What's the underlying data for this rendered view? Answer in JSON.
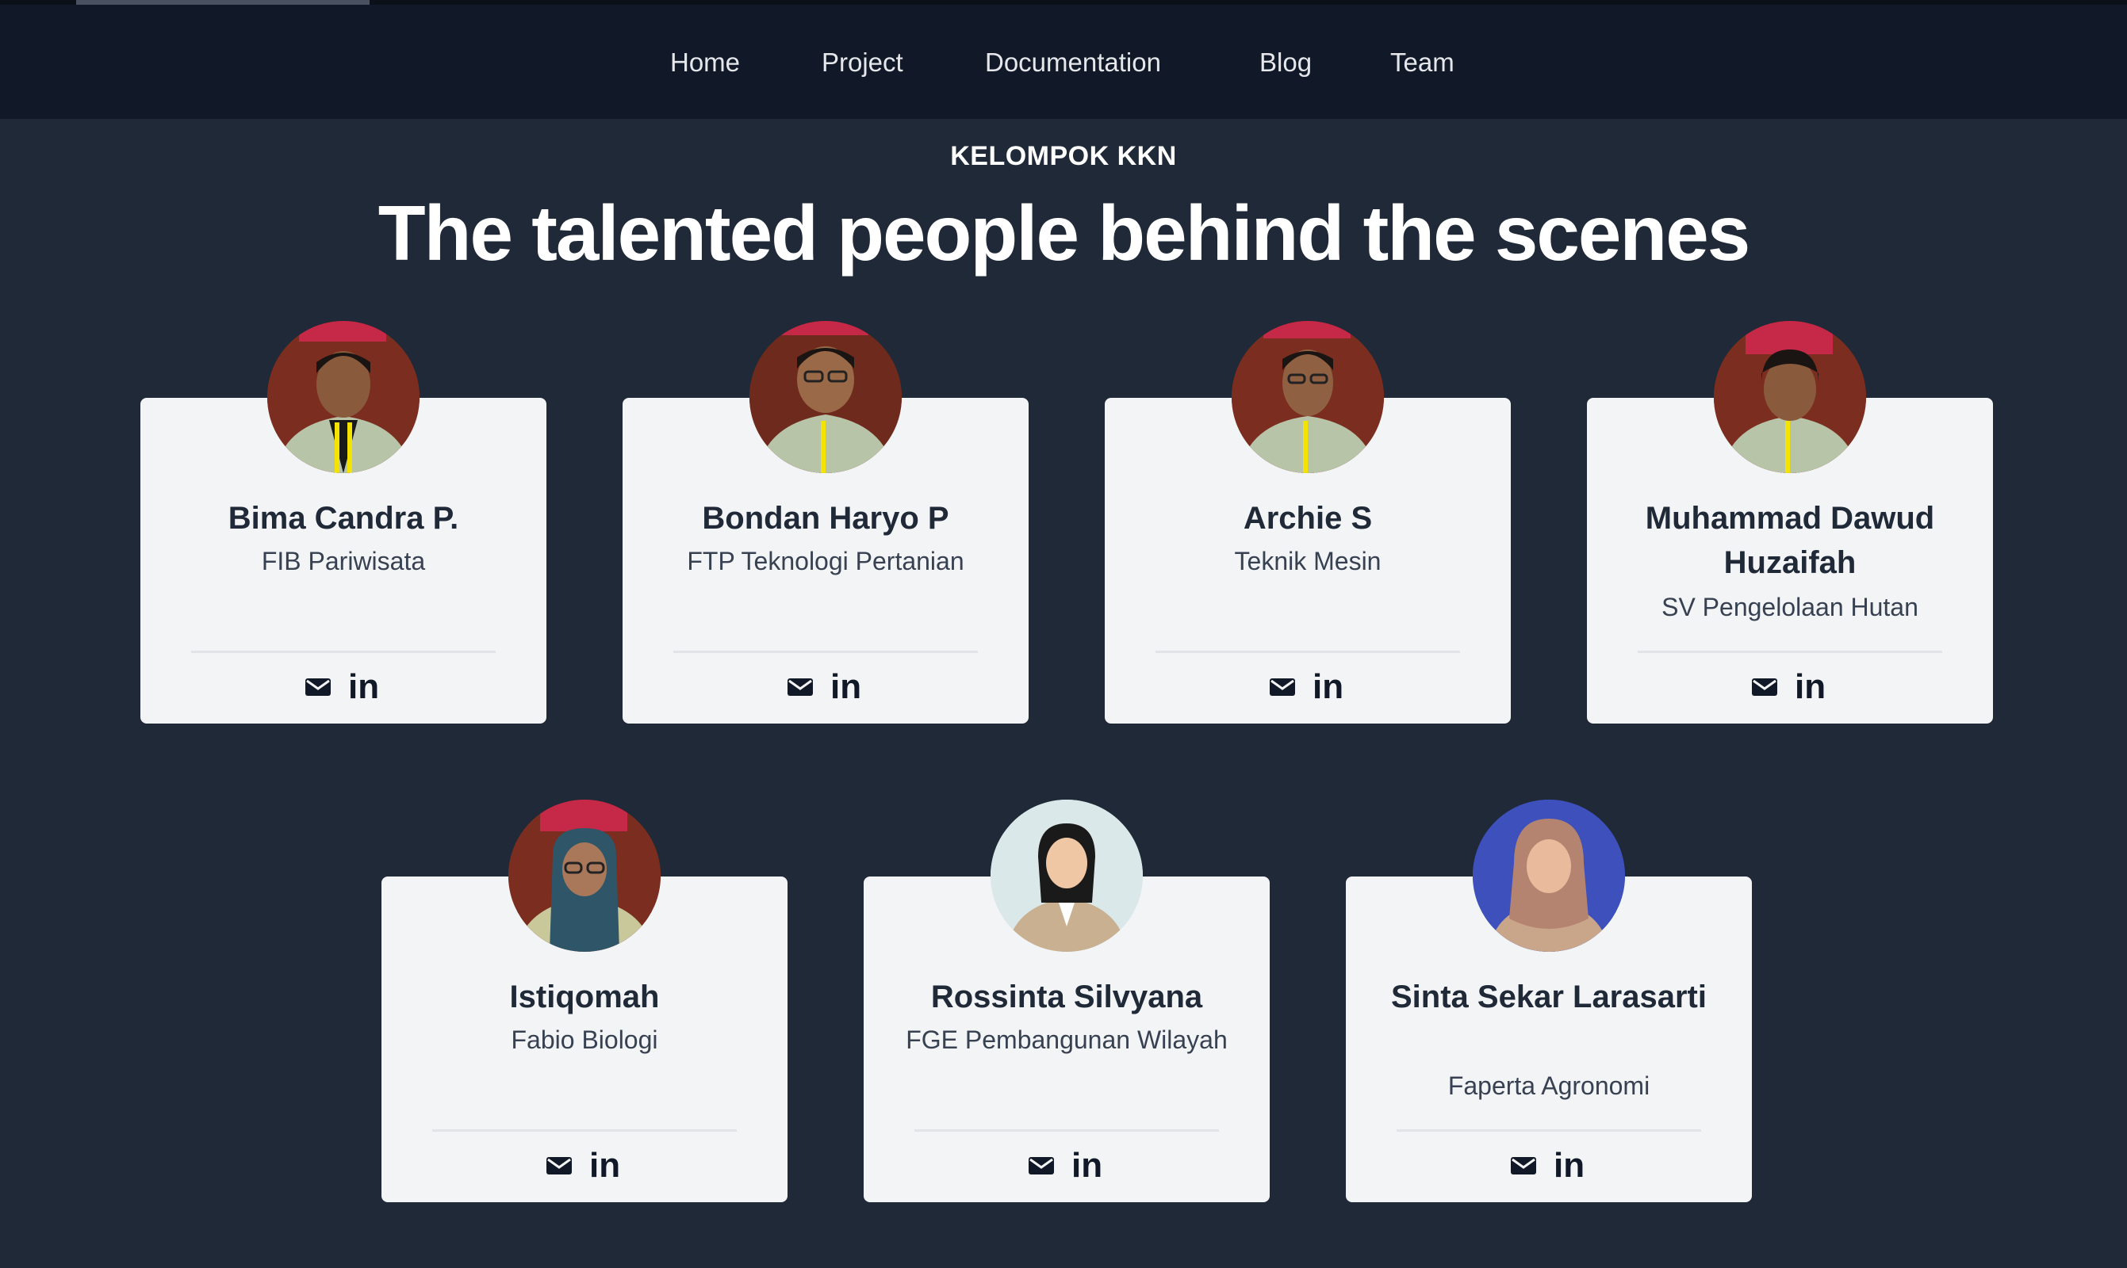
{
  "nav": {
    "items": [
      {
        "label": "Home"
      },
      {
        "label": "Project"
      },
      {
        "label": "Documentation"
      },
      {
        "label": "Blog"
      },
      {
        "label": "Team"
      }
    ]
  },
  "hero": {
    "eyebrow": "KELOMPOK KKN",
    "title": "The talented people behind the scenes"
  },
  "members": [
    {
      "name": "Bima Candra P.",
      "role": "FIB Pariwisata"
    },
    {
      "name": "Bondan Haryo P",
      "role": "FTP Teknologi Pertanian"
    },
    {
      "name": "Archie S",
      "role": "Teknik Mesin"
    },
    {
      "name": "Muhammad Dawud Huzaifah",
      "role": "SV Pengelolaan Hutan"
    },
    {
      "name": "Istiqomah",
      "role": "Fabio Biologi"
    },
    {
      "name": "Rossinta Silvyana",
      "role": "FGE Pembangunan Wilayah"
    },
    {
      "name": "Sinta Sekar Larasarti",
      "role": "Faperta Agronomi"
    }
  ],
  "social": {
    "linkedin_label": "in",
    "mail_icon": "mail-icon",
    "linkedin_icon": "linkedin-icon"
  },
  "colors": {
    "page_bg": "#1f2937",
    "nav_bg": "#111827",
    "card_bg": "#f3f4f6",
    "text_dark": "#1f2937"
  }
}
